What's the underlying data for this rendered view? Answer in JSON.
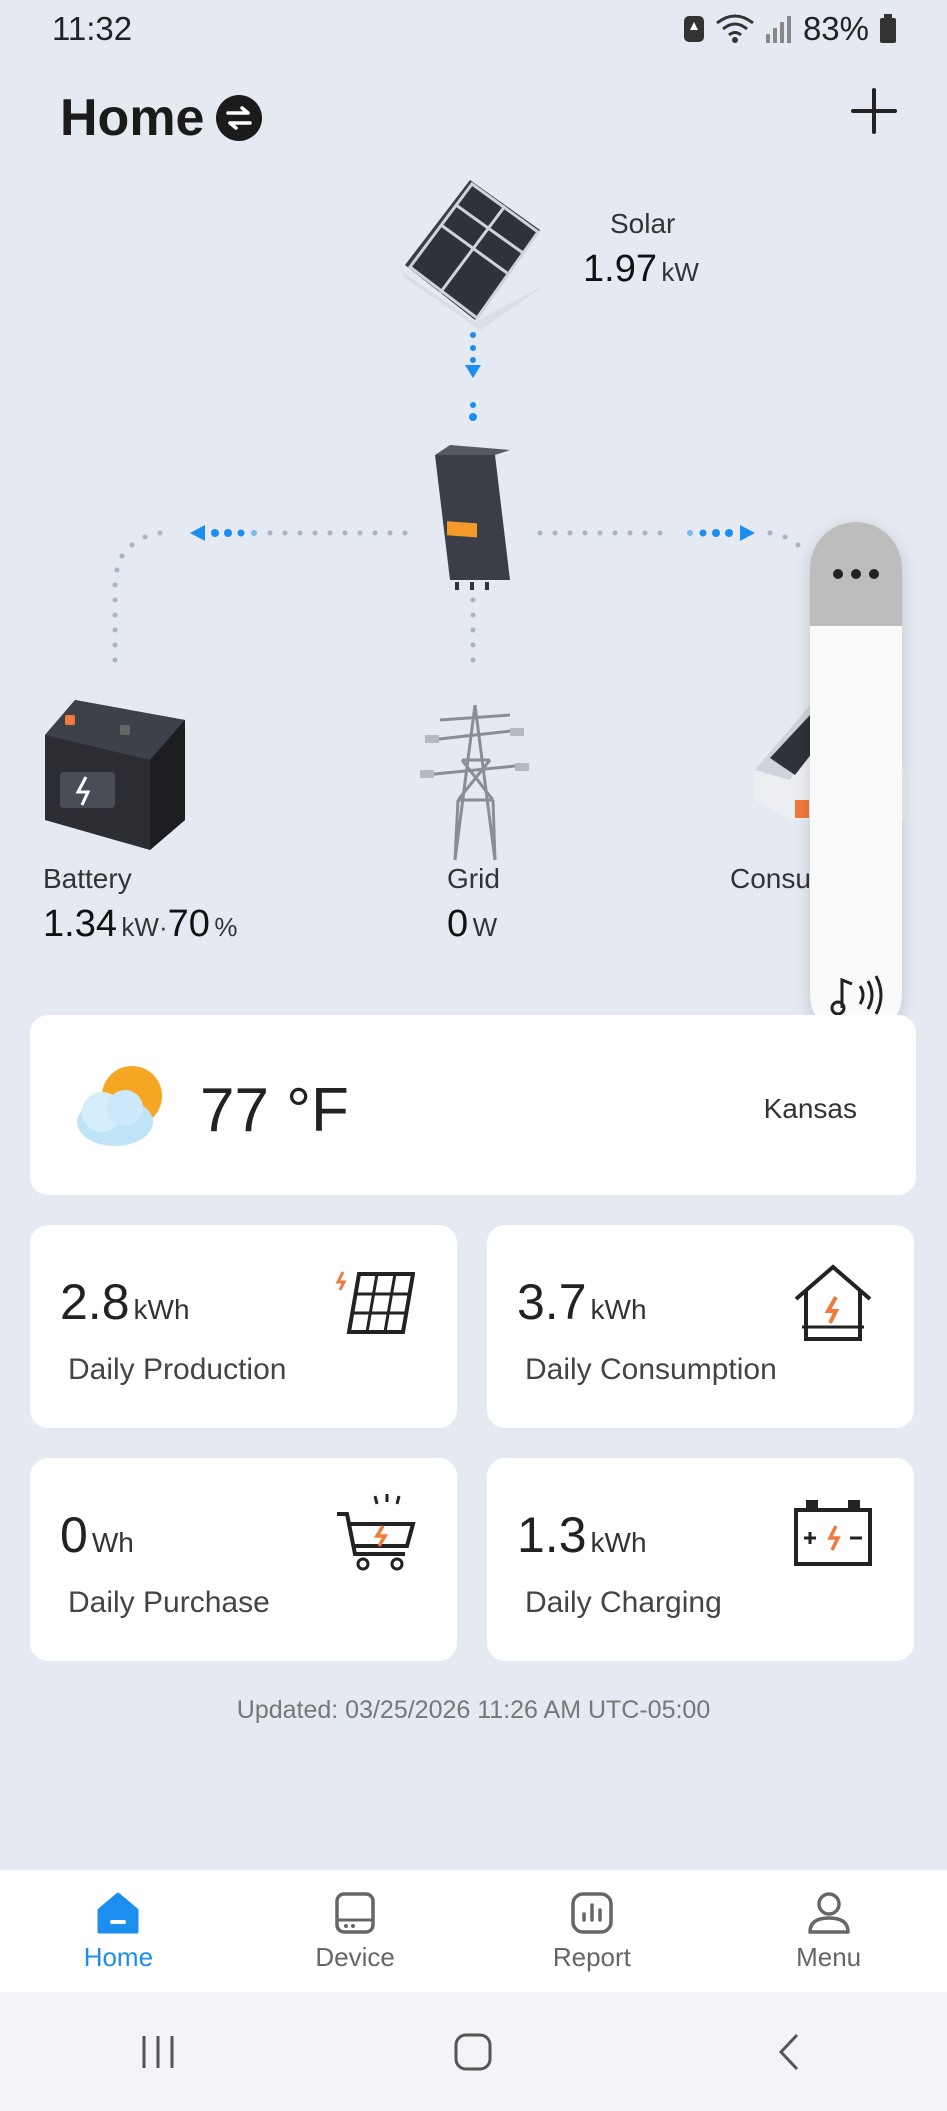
{
  "status_bar": {
    "time": "11:32",
    "battery": "83%"
  },
  "header": {
    "title": "Home"
  },
  "flow": {
    "solar": {
      "label": "Solar",
      "value": "1.97",
      "unit": "kW"
    },
    "battery": {
      "label": "Battery",
      "value": "1.34",
      "unit": "kW",
      "separator": "·",
      "soc": "70",
      "soc_unit": "%"
    },
    "grid": {
      "label": "Grid",
      "value": "0",
      "unit": "W"
    },
    "consumption": {
      "label": "Consu",
      "label_tail": "n"
    }
  },
  "weather": {
    "temp": "77 °F",
    "location": "Kansas"
  },
  "stats": [
    {
      "value": "2.8",
      "unit": "kWh",
      "label": "Daily Production"
    },
    {
      "value": "3.7",
      "unit": "kWh",
      "label": "Daily Consumption"
    },
    {
      "value": "0",
      "unit": "Wh",
      "label": "Daily Purchase"
    },
    {
      "value": "1.3",
      "unit": "kWh",
      "label": "Daily Charging"
    }
  ],
  "updated": "Updated: 03/25/2026 11:26 AM UTC-05:00",
  "nav": [
    {
      "label": "Home",
      "icon": "home-icon"
    },
    {
      "label": "Device",
      "icon": "device-icon"
    },
    {
      "label": "Report",
      "icon": "report-icon"
    },
    {
      "label": "Menu",
      "icon": "user-icon"
    }
  ],
  "colors": {
    "accent": "#1c8ef0",
    "orange": "#f07a3a",
    "bg": "#e4e9f2"
  }
}
